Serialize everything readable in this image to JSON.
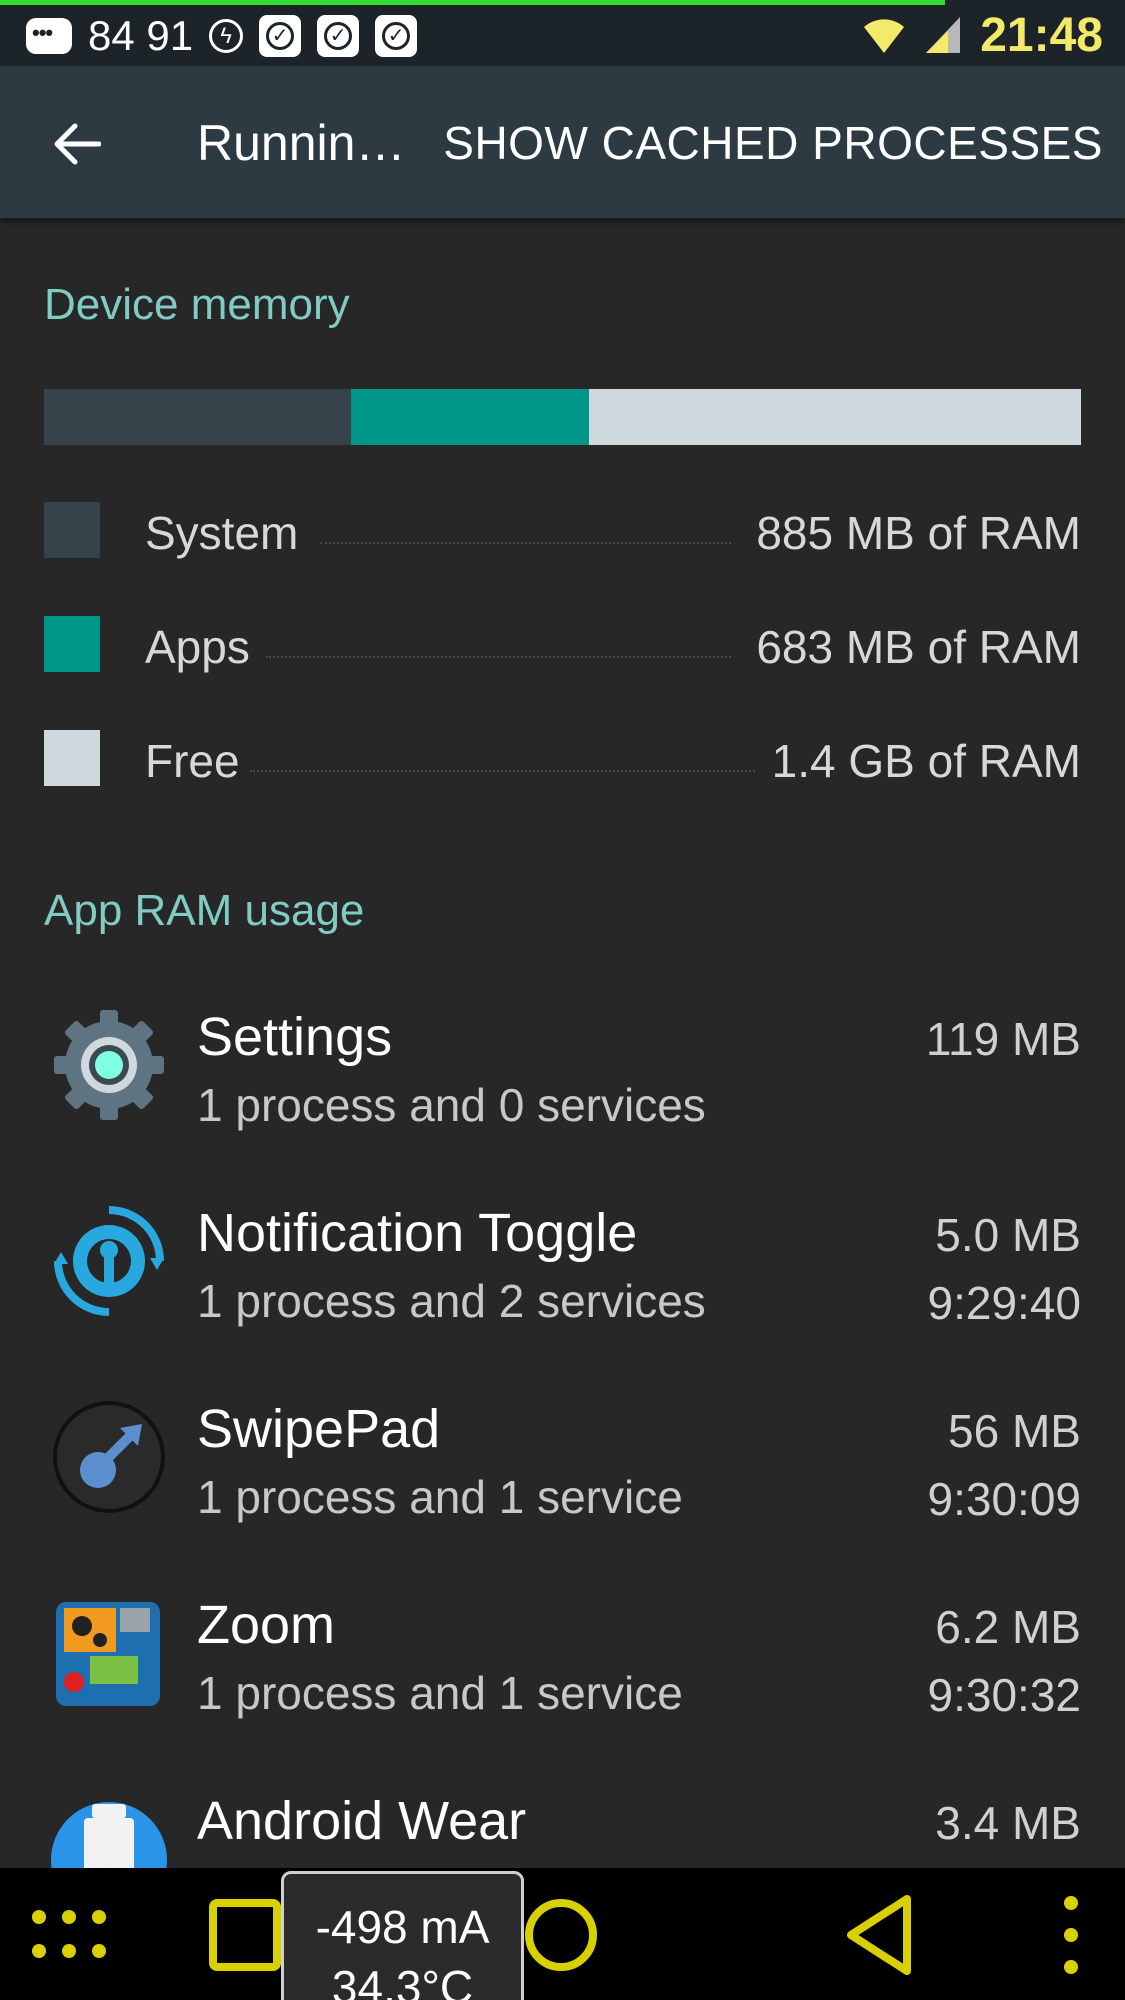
{
  "status_bar": {
    "numbers": "84 91",
    "time": "21:48",
    "colors": {
      "time": "#f4ea69",
      "top_progress": "#33dd33"
    },
    "icons": [
      "message-icon",
      "flash-icon",
      "check-icon",
      "check-icon",
      "check-icon",
      "wifi-icon",
      "signal-icon"
    ]
  },
  "toolbar": {
    "title": "Runnin…",
    "action_label": "SHOW CACHED PROCESSES"
  },
  "device_memory": {
    "header": "Device memory",
    "bar_fractions": {
      "system": 0.296,
      "apps": 0.23,
      "free": 0.474
    },
    "legend": [
      {
        "label": "System",
        "value": "885 MB of RAM",
        "color": "#37434b"
      },
      {
        "label": "Apps",
        "value": "683 MB of RAM",
        "color": "#009688"
      },
      {
        "label": "Free",
        "value": "1.4 GB of RAM",
        "color": "#cfd8dc"
      }
    ]
  },
  "app_ram": {
    "header": "App RAM usage",
    "apps": [
      {
        "name": "Settings",
        "sub": "1 process and 0 services",
        "size": "119 MB",
        "time": "",
        "icon": "settings-gear-icon"
      },
      {
        "name": "Notification Toggle",
        "sub": "1 process and 2 services",
        "size": "5.0 MB",
        "time": "9:29:40",
        "icon": "notification-toggle-icon"
      },
      {
        "name": "SwipePad",
        "sub": "1 process and 1 service",
        "size": "56 MB",
        "time": "9:30:09",
        "icon": "swipepad-icon"
      },
      {
        "name": "Zoom",
        "sub": "1 process and 1 service",
        "size": "6.2 MB",
        "time": "9:30:32",
        "icon": "zoom-app-icon"
      },
      {
        "name": "Android Wear",
        "sub": "",
        "size": "3.4 MB",
        "time": "",
        "icon": "android-wear-icon"
      }
    ]
  },
  "battery_overlay": {
    "current": "-498 mA",
    "temperature": "34.3°C"
  },
  "nav_bar": {
    "accent_color": "#d8d000",
    "icons": [
      "app-drawer-icon",
      "recents-icon",
      "home-icon",
      "back-icon",
      "menu-icon"
    ]
  }
}
